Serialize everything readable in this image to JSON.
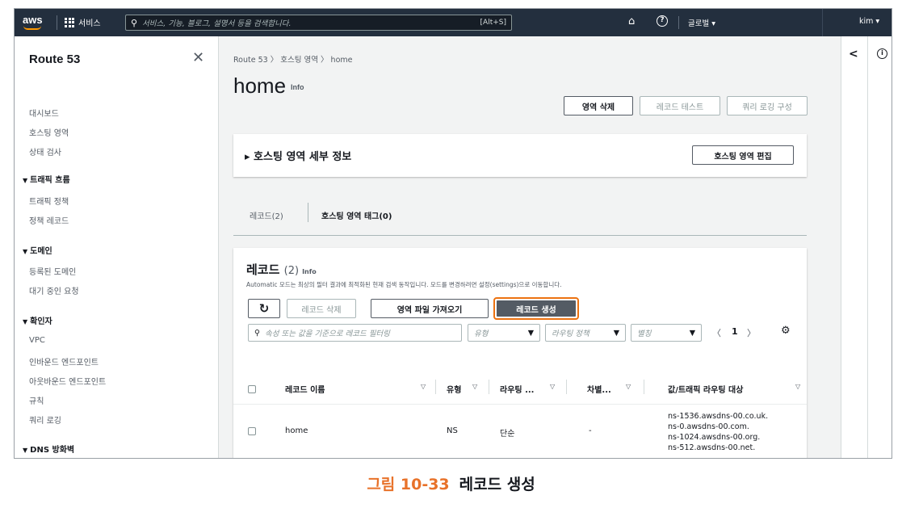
{
  "topbar": {
    "logo": "aws",
    "services_label": "서비스",
    "search_placeholder": "서비스, 기능, 블로그, 설명서 등을 검색합니다.",
    "search_shortcut": "[Alt+S]",
    "region_label": "글로벌 ▾",
    "user_label": "kim ▾",
    "icons": [
      "grid-icon",
      "search-icon",
      "bell-icon",
      "help-icon"
    ]
  },
  "sidebar": {
    "title": "Route 53",
    "close": "✕",
    "items": [
      "대시보드",
      "호스팅 영역",
      "상태 검사"
    ],
    "traffic_flow": {
      "title": "트래픽 흐름",
      "items": [
        "트래픽 정책",
        "정책 레코드"
      ]
    },
    "domains": {
      "title": "도메인",
      "items": [
        "등록된 도메인",
        "대기 중인 요청"
      ]
    },
    "resolver": {
      "title": "확인자",
      "items": [
        "VPC",
        "인바운드 엔드포인트",
        "아웃바운드 엔드포인트",
        "규칙",
        "쿼리 로깅"
      ]
    },
    "firewall": {
      "title": "DNS 방화벽"
    }
  },
  "main": {
    "breadcrumb": [
      "Route 53",
      "호스팅 영역",
      "home"
    ],
    "title": "home",
    "info_link": "Info",
    "actions": {
      "delete_zone": "영역 삭제",
      "test_record": "레코드 테스트",
      "query_logging": "쿼리 로깅 구성"
    },
    "details": {
      "title": "▸ 호스팅 영역 세부 정보",
      "edit_button": "호스팅 영역 편집"
    },
    "tabs": [
      "레코드(2)",
      "호스팅 영역 태그(0)"
    ],
    "records": {
      "title": "레코드",
      "count": "(2)",
      "info": "Info",
      "subtitle": "Automatic 모드는 최상의 필터 결과에 최적화된 현재 검색 동작입니다. 모드를 변경하려면 설정(settings)으로 이동합니다.",
      "refresh_icon": "refresh-icon",
      "delete_button": "레코드 삭제",
      "import_button": "영역 파일 가져오기",
      "create_button": "레코드 생성",
      "filter_placeholder": "속성 또는 값을 기준으로 레코드 필터링",
      "type_select": "유형",
      "routing_select": "라우팅 정책",
      "alias_select": "별칭",
      "page": "1",
      "columns": [
        "레코드 이름",
        "유형",
        "라우팅 ...",
        "차별...",
        "값/트래픽 라우팅 대상"
      ],
      "rows": [
        {
          "name": "home",
          "type": "NS",
          "routing": "단순",
          "diff": "-",
          "values": [
            "ns-1536.awsdns-00.co.uk.",
            "ns-0.awsdns-00.com.",
            "ns-1024.awsdns-00.org.",
            "ns-512.awsdns-00.net."
          ]
        }
      ]
    }
  },
  "rightpanel": {
    "arrow": "<",
    "info": "i"
  },
  "caption": {
    "number": "그림 10-33",
    "text": "레코드 생성"
  },
  "colors": {
    "topbar": "#232f3e",
    "accent": "#ec7211",
    "primary_button": "#545b64",
    "caption_number": "#e8722a"
  }
}
